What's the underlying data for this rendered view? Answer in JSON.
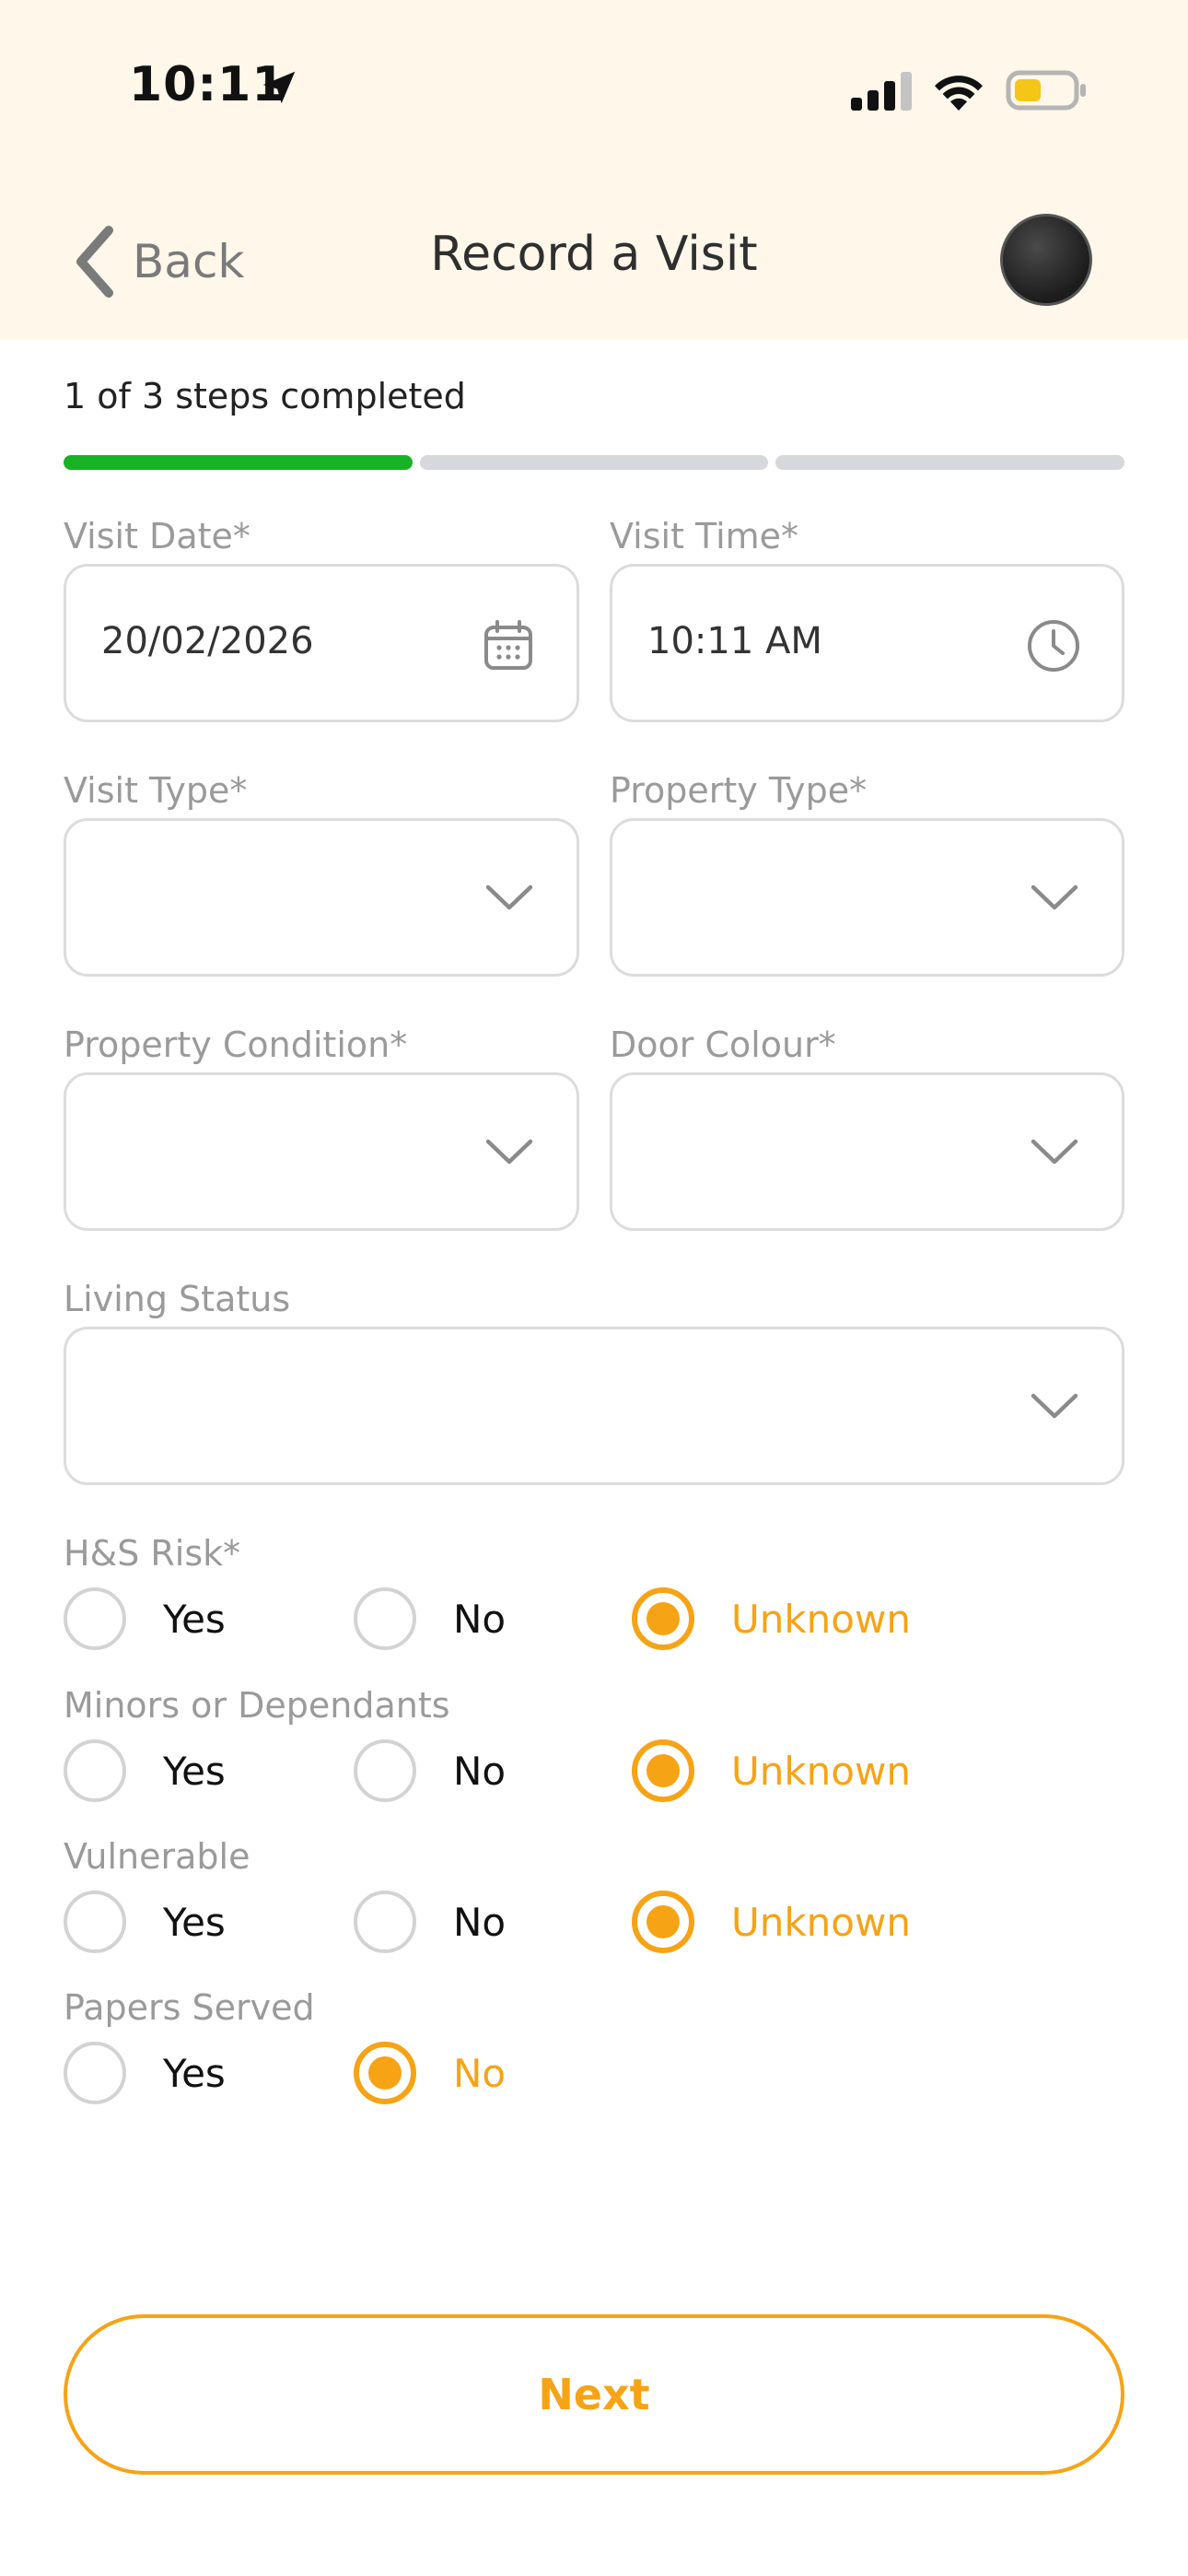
{
  "status_bar": {
    "time": "10:11"
  },
  "header": {
    "back_label": "Back",
    "title": "Record a Visit"
  },
  "progress": {
    "text": "1 of 3 steps completed",
    "completed_steps": 1,
    "total_steps": 3
  },
  "colors": {
    "accent": "#f6a316",
    "progress_done": "#17b324",
    "header_bg": "#fef7ea"
  },
  "fields": {
    "visit_date": {
      "label": "Visit Date*",
      "value": "20/02/2026",
      "icon": "calendar-icon"
    },
    "visit_time": {
      "label": "Visit Time*",
      "value": "10:11 AM",
      "icon": "clock-icon"
    },
    "visit_type": {
      "label": "Visit Type*",
      "value": ""
    },
    "property_type": {
      "label": "Property Type*",
      "value": ""
    },
    "property_condition": {
      "label": "Property Condition*",
      "value": ""
    },
    "door_colour": {
      "label": "Door Colour*",
      "value": ""
    },
    "living_status": {
      "label": "Living Status",
      "value": ""
    }
  },
  "radios": {
    "hs_risk": {
      "label": "H&S Risk*",
      "options": [
        "Yes",
        "No",
        "Unknown"
      ],
      "selected": "Unknown"
    },
    "minors": {
      "label": "Minors or Dependants",
      "options": [
        "Yes",
        "No",
        "Unknown"
      ],
      "selected": "Unknown"
    },
    "vulnerable": {
      "label": "Vulnerable",
      "options": [
        "Yes",
        "No",
        "Unknown"
      ],
      "selected": "Unknown"
    },
    "papers_served": {
      "label": "Papers Served",
      "options": [
        "Yes",
        "No"
      ],
      "selected": "No"
    }
  },
  "actions": {
    "next_label": "Next"
  }
}
